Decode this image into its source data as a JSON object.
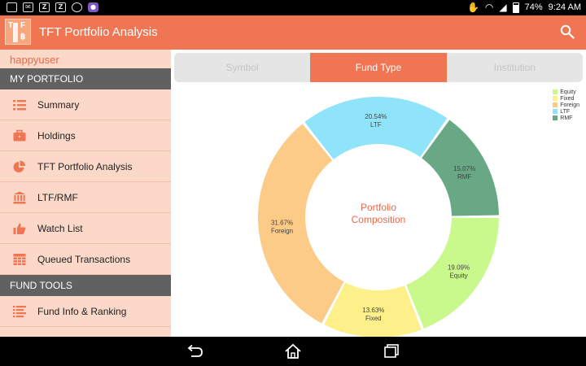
{
  "status_bar": {
    "left_icons": [
      "image-icon",
      "mail-icon",
      "z-icon",
      "z-icon",
      "sync-icon",
      "app-icon"
    ],
    "battery": "74%",
    "time": "9:24 AM"
  },
  "app": {
    "title": "TFT Portfolio Analysis",
    "logo_letters": [
      "T",
      "F",
      "฿"
    ]
  },
  "sidebar": {
    "username": "happyuser",
    "sections": [
      {
        "title": "MY PORTFOLIO",
        "items": [
          {
            "label": "Summary",
            "icon": "list-icon"
          },
          {
            "label": "Holdings",
            "icon": "briefcase-icon"
          },
          {
            "label": "TFT Portfolio Analysis",
            "icon": "pie-chart-icon"
          },
          {
            "label": "LTF/RMF",
            "icon": "bank-icon"
          },
          {
            "label": "Watch List",
            "icon": "thumbs-up-icon"
          },
          {
            "label": "Queued Transactions",
            "icon": "table-icon"
          }
        ]
      },
      {
        "title": "FUND TOOLS",
        "items": [
          {
            "label": "Fund Info & Ranking",
            "icon": "ranking-list-icon"
          }
        ]
      }
    ]
  },
  "tabs": [
    {
      "label": "Symbol",
      "active": false
    },
    {
      "label": "Fund Type",
      "active": true
    },
    {
      "label": "Institution",
      "active": false
    }
  ],
  "colors": {
    "accent": "#f07553",
    "Equity": "#c9f98d",
    "Fixed": "#fdf08a",
    "Foreign": "#fccb88",
    "LTF": "#8fe4fa",
    "RMF": "#68a885"
  },
  "chart_data": {
    "type": "pie",
    "donut": true,
    "center_text": [
      "Portfolio",
      "Composition"
    ],
    "legend_placement": "top-right",
    "series": [
      {
        "name": "Equity",
        "value": 19.09,
        "label": "19.09%"
      },
      {
        "name": "Fixed",
        "value": 13.63,
        "label": "13.63%"
      },
      {
        "name": "Foreign",
        "value": 31.67,
        "label": "31.67%"
      },
      {
        "name": "LTF",
        "value": 20.54,
        "label": "20.54%"
      },
      {
        "name": "RMF",
        "value": 15.07,
        "label": "15.07%"
      }
    ]
  },
  "navbar": [
    "back-icon",
    "home-icon",
    "recents-icon"
  ]
}
